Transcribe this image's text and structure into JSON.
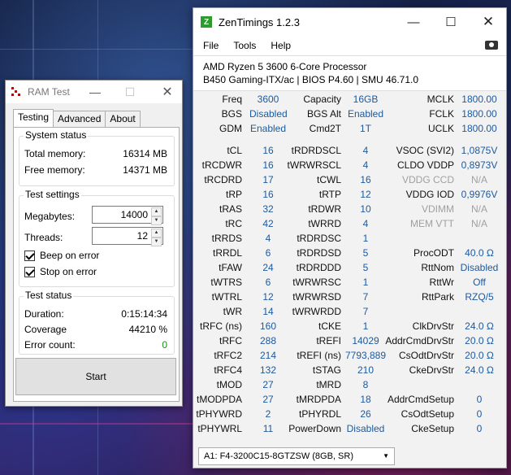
{
  "ramtest": {
    "title": "RAM Test",
    "tabs": [
      "Testing",
      "Advanced",
      "About"
    ],
    "system_status": {
      "title": "System status",
      "total_label": "Total memory:",
      "total_value": "16314 MB",
      "free_label": "Free memory:",
      "free_value": "14371 MB"
    },
    "test_settings": {
      "title": "Test settings",
      "megabytes_label": "Megabytes:",
      "megabytes_value": "14000",
      "threads_label": "Threads:",
      "threads_value": "12",
      "beep_label": "Beep on error",
      "stop_label": "Stop on error"
    },
    "test_status": {
      "title": "Test status",
      "duration_label": "Duration:",
      "duration_value": "0:15:14:34",
      "coverage_label": "Coverage",
      "coverage_value": "44210 %",
      "errors_label": "Error count:",
      "errors_value": "0"
    },
    "start_label": "Start"
  },
  "zen": {
    "title": "ZenTimings 1.2.3",
    "menu": [
      "File",
      "Tools",
      "Help"
    ],
    "cpu": "AMD Ryzen 5 3600 6-Core Processor",
    "board": "B450 Gaming-ITX/ac | BIOS P4.60 | SMU 46.71.0",
    "top": [
      [
        "Freq",
        "3600",
        "Capacity",
        "16GB",
        "MCLK",
        "1800.00"
      ],
      [
        "BGS",
        "Disabled",
        "BGS Alt",
        "Enabled",
        "FCLK",
        "1800.00"
      ],
      [
        "GDM",
        "Enabled",
        "Cmd2T",
        "1T",
        "UCLK",
        "1800.00"
      ]
    ],
    "timings": [
      [
        "tCL",
        "16",
        "tRDRDSCL",
        "4",
        "VSOC (SVI2)",
        "1,0875V"
      ],
      [
        "tRCDWR",
        "16",
        "tWRWRSCL",
        "4",
        "CLDO VDDP",
        "0,8973V"
      ],
      [
        "tRCDRD",
        "17",
        "tCWL",
        "16",
        "VDDG CCD",
        "N/A"
      ],
      [
        "tRP",
        "16",
        "tRTP",
        "12",
        "VDDG IOD",
        "0,9976V"
      ],
      [
        "tRAS",
        "32",
        "tRDWR",
        "10",
        "VDIMM",
        "N/A"
      ],
      [
        "tRC",
        "42",
        "tWRRD",
        "4",
        "MEM VTT",
        "N/A"
      ],
      [
        "tRRDS",
        "4",
        "tRDRDSC",
        "1",
        "",
        ""
      ],
      [
        "tRRDL",
        "6",
        "tRDRDSD",
        "5",
        "ProcODT",
        "40.0 Ω"
      ],
      [
        "tFAW",
        "24",
        "tRDRDDD",
        "5",
        "RttNom",
        "Disabled"
      ],
      [
        "tWTRS",
        "6",
        "tWRWRSC",
        "1",
        "RttWr",
        "Off"
      ],
      [
        "tWTRL",
        "12",
        "tWRWRSD",
        "7",
        "RttPark",
        "RZQ/5"
      ],
      [
        "tWR",
        "14",
        "tWRWRDD",
        "7",
        "",
        ""
      ],
      [
        "tRFC (ns)",
        "160",
        "tCKE",
        "1",
        "ClkDrvStr",
        "24.0 Ω"
      ],
      [
        "tRFC",
        "288",
        "tREFI",
        "14029",
        "AddrCmdDrvStr",
        "20.0 Ω"
      ],
      [
        "tRFC2",
        "214",
        "tREFI (ns)",
        "7793,889",
        "CsOdtDrvStr",
        "20.0 Ω"
      ],
      [
        "tRFC4",
        "132",
        "tSTAG",
        "210",
        "CkeDrvStr",
        "24.0 Ω"
      ],
      [
        "tMOD",
        "27",
        "tMRD",
        "8",
        "",
        ""
      ],
      [
        "tMODPDA",
        "27",
        "tMRDPDA",
        "18",
        "AddrCmdSetup",
        "0"
      ],
      [
        "tPHYWRD",
        "2",
        "tPHYRDL",
        "26",
        "CsOdtSetup",
        "0"
      ],
      [
        "tPHYWRL",
        "11",
        "PowerDown",
        "Disabled",
        "CkeSetup",
        "0"
      ]
    ],
    "dimmed": [
      "VDDG CCD",
      "VDIMM",
      "MEM VTT"
    ],
    "module": "A1: F4-3200C15-8GTZSW (8GB, SR)"
  }
}
